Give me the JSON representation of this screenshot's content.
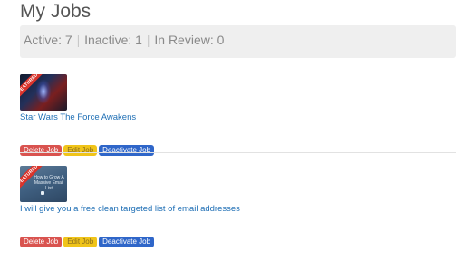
{
  "page": {
    "title": "My Jobs"
  },
  "stats": {
    "active": "Active: 7",
    "inactive": "Inactive: 1",
    "in_review": "In Review: 0"
  },
  "jobs": [
    {
      "title": "Star Wars The Force Awakens",
      "badge": "FEATURED",
      "thumbnail_text": "",
      "actions": {
        "delete": "Delete Job",
        "edit": "Edit Job",
        "deactivate": "Deactivate Job"
      }
    },
    {
      "title": "I will give you a free clean targeted list of email addresses",
      "badge": "FEATURED",
      "thumbnail_text": "How to Grow A Massive Email List",
      "actions": {
        "delete": "Delete Job",
        "edit": "Edit Job",
        "deactivate": "Deactivate Job"
      }
    }
  ],
  "colors": {
    "delete": "#d9534f",
    "edit": "#f0c419",
    "deactivate": "#2f66c9",
    "link": "#1f6fb5",
    "ribbon": "#d9342b"
  }
}
